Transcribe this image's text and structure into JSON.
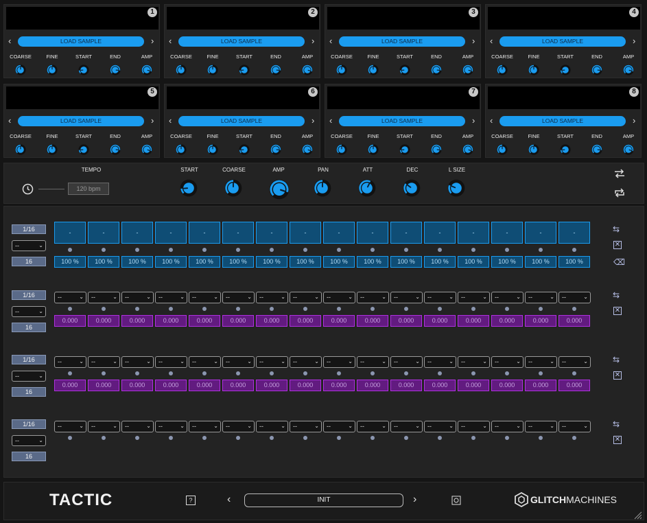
{
  "slots": [
    {
      "num": "1",
      "load": "LOAD SAMPLE"
    },
    {
      "num": "2",
      "load": "LOAD SAMPLE"
    },
    {
      "num": "3",
      "load": "LOAD SAMPLE"
    },
    {
      "num": "4",
      "load": "LOAD SAMPLE"
    },
    {
      "num": "5",
      "load": "LOAD SAMPLE"
    },
    {
      "num": "6",
      "load": "LOAD SAMPLE"
    },
    {
      "num": "7",
      "load": "LOAD SAMPLE"
    },
    {
      "num": "8",
      "load": "LOAD SAMPLE"
    }
  ],
  "slot_knob_labels": [
    "COARSE",
    "FINE",
    "START",
    "END",
    "AMP"
  ],
  "slot_knob_levels": [
    0.5,
    0.5,
    0.15,
    0.85,
    0.9
  ],
  "main": {
    "tempo_label": "TEMPO",
    "tempo_value": "120 bpm",
    "knobs": [
      {
        "label": "START",
        "level": 0.15
      },
      {
        "label": "COARSE",
        "level": 0.5
      },
      {
        "label": "AMP",
        "level": 0.9
      },
      {
        "label": "PAN",
        "level": 0.5
      },
      {
        "label": "ATT",
        "level": 0.6
      },
      {
        "label": "DEC",
        "level": 0.3
      },
      {
        "label": "L SIZE",
        "level": 0.25
      }
    ]
  },
  "rows": [
    {
      "rate": "1/16",
      "mode": "--",
      "steps": "16",
      "type": "pitch",
      "cells": [
        "-",
        "-",
        "-",
        "-",
        "-",
        "-",
        "-",
        "-",
        "-",
        "-",
        "-",
        "-",
        "-",
        "-",
        "-",
        "-"
      ],
      "values": [
        "100 %",
        "100 %",
        "100 %",
        "100 %",
        "100 %",
        "100 %",
        "100 %",
        "100 %",
        "100 %",
        "100 %",
        "100 %",
        "100 %",
        "100 %",
        "100 %",
        "100 %",
        "100 %"
      ]
    },
    {
      "rate": "1/16",
      "mode": "--",
      "steps": "16",
      "type": "param",
      "cells": [
        "--",
        "--",
        "--",
        "--",
        "--",
        "--",
        "--",
        "--",
        "--",
        "--",
        "--",
        "--",
        "--",
        "--",
        "--",
        "--"
      ],
      "values": [
        "0.000",
        "0.000",
        "0.000",
        "0.000",
        "0.000",
        "0.000",
        "0.000",
        "0.000",
        "0.000",
        "0.000",
        "0.000",
        "0.000",
        "0.000",
        "0.000",
        "0.000",
        "0.000"
      ]
    },
    {
      "rate": "1/16",
      "mode": "--",
      "steps": "16",
      "type": "param",
      "cells": [
        "--",
        "--",
        "--",
        "--",
        "--",
        "--",
        "--",
        "--",
        "--",
        "--",
        "--",
        "--",
        "--",
        "--",
        "--",
        "--"
      ],
      "values": [
        "0.000",
        "0.000",
        "0.000",
        "0.000",
        "0.000",
        "0.000",
        "0.000",
        "0.000",
        "0.000",
        "0.000",
        "0.000",
        "0.000",
        "0.000",
        "0.000",
        "0.000",
        "0.000"
      ]
    },
    {
      "rate": "1/16",
      "mode": "--",
      "steps": "16",
      "type": "sel",
      "cells": [
        "--",
        "--",
        "--",
        "--",
        "--",
        "--",
        "--",
        "--",
        "--",
        "--",
        "--",
        "--",
        "--",
        "--",
        "--",
        "--"
      ],
      "values": []
    }
  ],
  "footer": {
    "logo": "TACTIC",
    "help": "?",
    "preset": "INIT",
    "brand_a": "GLITCH",
    "brand_b": "MACHINES"
  },
  "colors": {
    "accent": "#1a9cf0",
    "purple": "#621b80",
    "panel": "#232323"
  }
}
